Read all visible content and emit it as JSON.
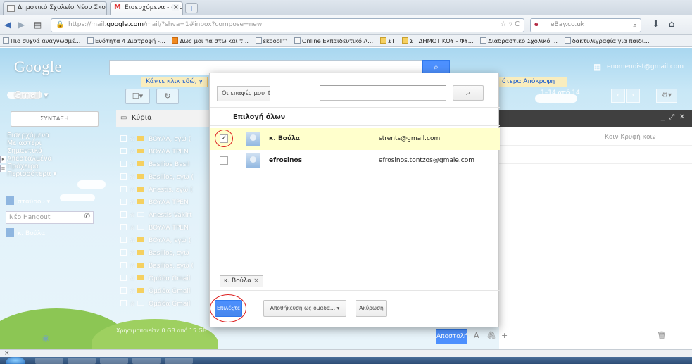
{
  "browser": {
    "tabs": [
      {
        "label": "Δημοτικό Σχολείο Νέου Σκοπού",
        "active": false
      },
      {
        "label": "Εισερχόμενα - enomenoist@gmail.co...",
        "active": true
      }
    ],
    "tab_close": "×",
    "new_tab": "+",
    "url_prefix": "https://mail.",
    "url_host": "google.com",
    "url_suffix": "/mail/?shva=1#inbox?compose=new",
    "url_controls": "☆ ▿ C",
    "search_engine": "e",
    "search_value": "eBay.co.uk",
    "bookmarks": [
      "Πιο συχνά αναγνωσμέ...",
      "Ενότητα 4 Διατροφή -...",
      "Δως μοι πα στω και τ...",
      "skoool™",
      "Online Εκπαιδευτικό Λ...",
      "ΣΤ",
      "ΣΤ ΔΗΜΟΤΙΚΟΥ - ΦΥ...",
      "Διαδραστικό Σχολικό ...",
      "δακτυλιγραφία για παιδι..."
    ]
  },
  "gmail": {
    "logo": "Google",
    "account": "enomenoist@gmail.com",
    "label": "Gmail",
    "label_caret": "▾",
    "notice_text": "Κάντε κλικ εδώ, γ",
    "notice_right": "ότερα Απόκρυψη",
    "pager_text": "1–14 από 14",
    "compose_label": "ΣΥΝΤΑΞΗ",
    "sidebar_items": [
      "Εισερχόμενα",
      "Με αστέρι",
      "Σημαντικά",
      "Απεσταλμένα",
      "Πρόχειρα",
      "Περισσότερα ▾"
    ],
    "hangout_user": "σταύρου",
    "hangout_placeholder": "Νέο Hangout",
    "hangout_contact": "κ. Βούλα",
    "list_header": "Κύρια",
    "mail_rows": [
      {
        "sender": "BOYΛA, εγώ (",
        "tag": true
      },
      {
        "sender": "BOYΛA TPEN",
        "tag": true
      },
      {
        "sender": "Basilios Basil",
        "tag": true
      },
      {
        "sender": "Basilios, εγώ (",
        "tag": true
      },
      {
        "sender": "Anestis, εγώ (",
        "tag": true
      },
      {
        "sender": "BOYΛA TPEN",
        "tag": true
      },
      {
        "sender": "Anestis Vakirt",
        "tag": false
      },
      {
        "sender": "BOYΛA TPEN",
        "tag": false
      },
      {
        "sender": "BOYΛA, εγώ (",
        "tag": true
      },
      {
        "sender": "Basilios, εγώ",
        "tag": true
      },
      {
        "sender": "Basilios, εγώ (",
        "tag": true
      },
      {
        "sender": "Ομάδα Gmail",
        "tag": true
      },
      {
        "sender": "Ομάδα Gmail",
        "tag": true
      },
      {
        "sender": "Ομάδα Gmail",
        "tag": false
      }
    ],
    "compose_links": "Κοιν Κρυφή κοιν",
    "bottom_text": "Χρησιμοποιείτε 0 GB από 15 GB",
    "send_label": "Αποστολή"
  },
  "dialog": {
    "filter_value": "Οι επαφές μου ⇕",
    "search_placeholder": "",
    "search_icon": "magnifier-icon",
    "select_all": "Επιλογή όλων",
    "contacts": [
      {
        "name": "κ. Βούλα",
        "email": "strents@gmail.com",
        "checked": true
      },
      {
        "name": "efrosinos",
        "email": "efrosinos.tontzos@gmale.com",
        "checked": false
      }
    ],
    "chip_label": "κ. Βούλα",
    "chip_remove": "×",
    "select_button": "Επιλέξτε",
    "save_group_button": "Αποθήκευση ως ομάδα... ▾",
    "cancel_button": "Ακύρωση",
    "highlight_color": "#ffffcc",
    "annotation_color": "#dd2222"
  },
  "statusbar": {
    "text": "×"
  }
}
